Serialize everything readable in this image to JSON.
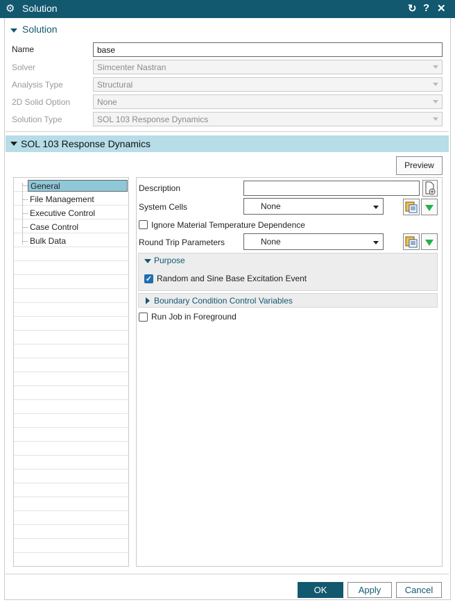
{
  "window": {
    "title": "Solution",
    "icons": [
      "gear-icon",
      "reset-icon",
      "help-icon",
      "close-icon"
    ],
    "help_glyph": "?"
  },
  "solution_section": {
    "title": "Solution",
    "fields": [
      {
        "label": "Name",
        "value": "base"
      },
      {
        "label": "Solver",
        "value": "Simcenter Nastran"
      },
      {
        "label": "Analysis Type",
        "value": "Structural"
      },
      {
        "label": "2D Solid Option",
        "value": "None"
      },
      {
        "label": "Solution Type",
        "value": "SOL 103 Response Dynamics"
      }
    ]
  },
  "sol_section": {
    "title": "SOL 103 Response Dynamics",
    "preview_label": "Preview"
  },
  "tree": {
    "items": [
      "General",
      "File Management",
      "Executive Control",
      "Case Control",
      "Bulk Data"
    ],
    "selected": "General"
  },
  "general_panel": {
    "description_label": "Description",
    "description_value": "",
    "system_cells_label": "System Cells",
    "system_cells_value": "None",
    "ignore_temp_label": "Ignore Material Temperature Dependence",
    "ignore_temp_checked": false,
    "round_trip_label": "Round Trip Parameters",
    "round_trip_value": "None",
    "purpose_title": "Purpose",
    "purpose_option_label": "Random and Sine Base Excitation Event",
    "purpose_option_checked": true,
    "boundary_title": "Boundary Condition Control Variables",
    "foreground_label": "Run Job in Foreground",
    "foreground_checked": false
  },
  "footer": {
    "ok_label": "OK",
    "apply_label": "Apply",
    "cancel_label": "Cancel"
  },
  "colors": {
    "title_bar": "#12586f",
    "section_bar": "#b6dde8",
    "tree_selection": "#8fc8d8",
    "accent_green": "#22b14c"
  }
}
